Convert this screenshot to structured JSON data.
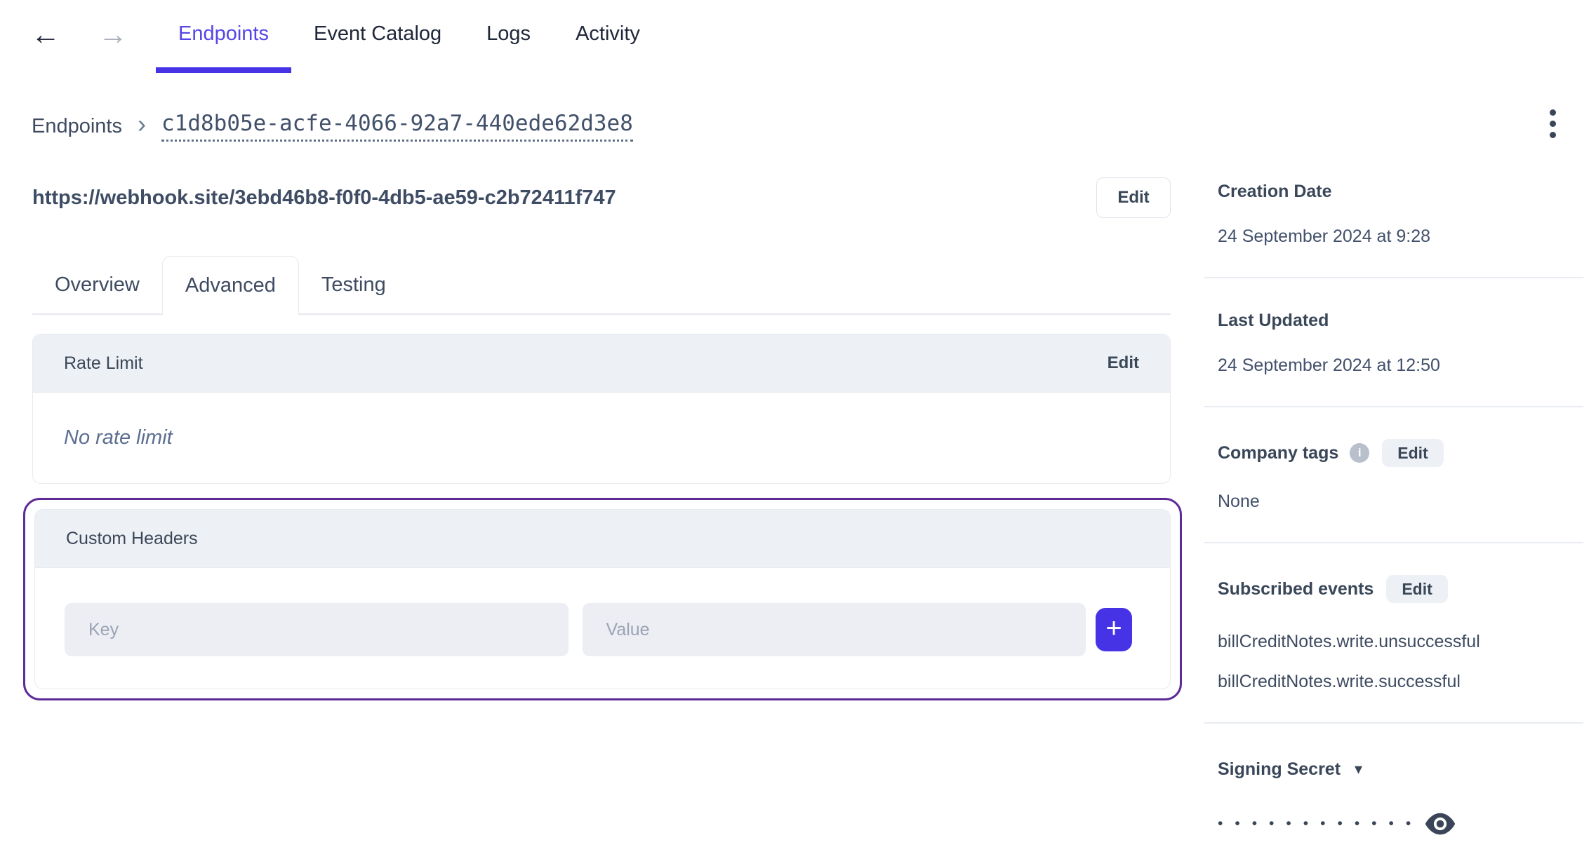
{
  "colors": {
    "accent_purple": "#4633e6",
    "active_tab_text": "#5746e5",
    "highlight_outline": "#5e2b97",
    "card_header_bg": "#edf0f4",
    "text_dark": "#3e4b61"
  },
  "icons": {
    "back": "←",
    "forward": "→",
    "breadcrumb_chevron": "›",
    "dropdown_caret": "▾",
    "info": "i",
    "add": "+"
  },
  "topnav": {
    "tabs": [
      {
        "label": "Endpoints",
        "active": true
      },
      {
        "label": "Event Catalog",
        "active": false
      },
      {
        "label": "Logs",
        "active": false
      },
      {
        "label": "Activity",
        "active": false
      }
    ]
  },
  "breadcrumb": {
    "root": "Endpoints",
    "endpoint_id": "c1d8b05e-acfe-4066-92a7-440ede62d3e8"
  },
  "endpoint": {
    "url": "https://webhook.site/3ebd46b8-f0f0-4db5-ae59-c2b72411f747",
    "edit_label": "Edit"
  },
  "detail_tabs": [
    {
      "label": "Overview",
      "active": false
    },
    {
      "label": "Advanced",
      "active": true
    },
    {
      "label": "Testing",
      "active": false
    }
  ],
  "rate_limit": {
    "title": "Rate Limit",
    "edit_label": "Edit",
    "empty_text": "No rate limit"
  },
  "custom_headers": {
    "title": "Custom Headers",
    "key_placeholder": "Key",
    "value_placeholder": "Value"
  },
  "sidebar": {
    "creation_date": {
      "label": "Creation Date",
      "value": "24 September 2024 at 9:28"
    },
    "last_updated": {
      "label": "Last Updated",
      "value": "24 September 2024 at 12:50"
    },
    "company_tags": {
      "label": "Company tags",
      "edit_label": "Edit",
      "value": "None"
    },
    "subscribed_events": {
      "label": "Subscribed events",
      "edit_label": "Edit",
      "events": [
        "billCreditNotes.write.unsuccessful",
        "billCreditNotes.write.successful"
      ]
    },
    "signing_secret": {
      "label": "Signing Secret",
      "masked_value": "••••••••••••"
    }
  }
}
